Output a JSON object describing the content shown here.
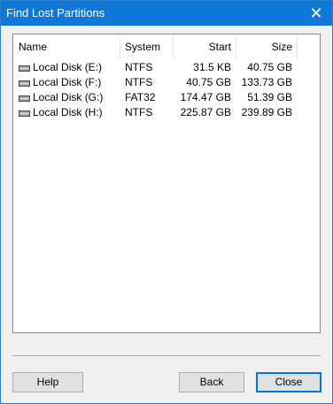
{
  "window": {
    "title": "Find Lost Partitions",
    "close_glyph": "✕"
  },
  "table": {
    "columns": [
      "Name",
      "System",
      "Start",
      "Size"
    ],
    "rows": [
      {
        "name": "Local Disk (E:)",
        "system": "NTFS",
        "start": "31.5 KB",
        "size": "40.75 GB"
      },
      {
        "name": "Local Disk (F:)",
        "system": "NTFS",
        "start": "40.75 GB",
        "size": "133.73 GB"
      },
      {
        "name": "Local Disk (G:)",
        "system": "FAT32",
        "start": "174.47 GB",
        "size": "51.39 GB"
      },
      {
        "name": "Local Disk (H:)",
        "system": "NTFS",
        "start": "225.87 GB",
        "size": "239.89 GB"
      }
    ],
    "row_icon": "drive-icon"
  },
  "buttons": {
    "help": "Help",
    "back": "Back",
    "close": "Close"
  },
  "colors": {
    "titlebar": "#0f78d7",
    "dialog_bg": "#f0f0f0"
  }
}
